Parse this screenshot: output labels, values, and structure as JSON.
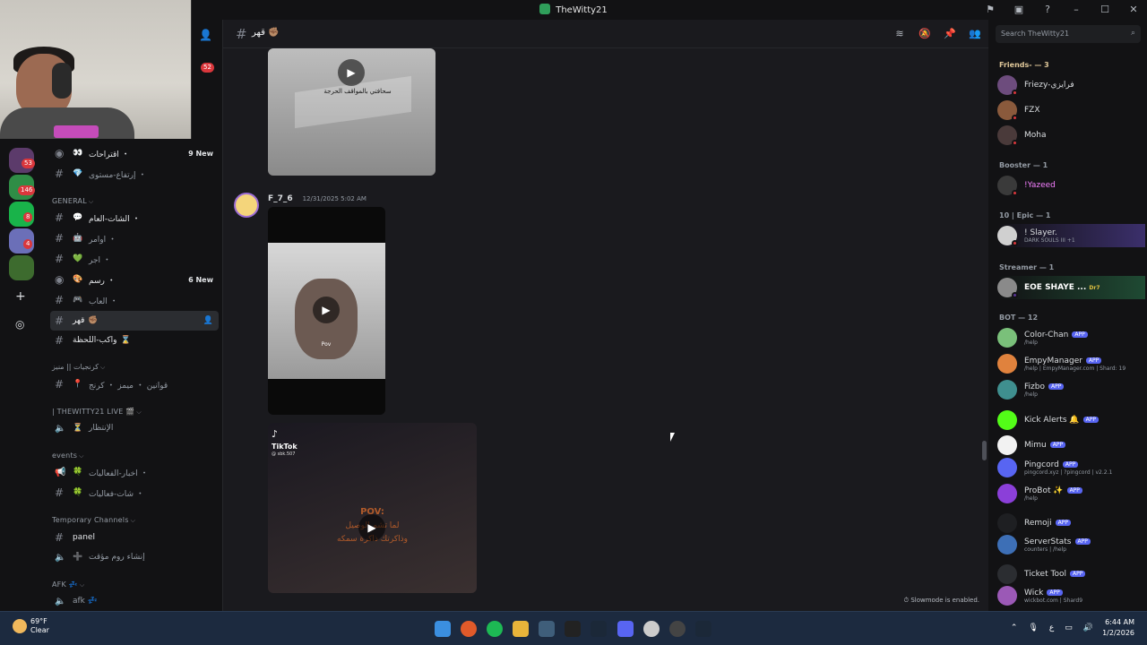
{
  "window": {
    "title": "TheWitty21"
  },
  "channels": {
    "items": [
      {
        "label": "اقتراحات ・",
        "emoji": "👀",
        "type": "text",
        "new": "9 New"
      },
      {
        "label": "إرتفاع-مستوى ・",
        "emoji": "💎",
        "type": "text"
      }
    ],
    "general_cat": "GENERAL",
    "general": [
      {
        "label": "الشات-العام ・",
        "emoji": "💬"
      },
      {
        "label": "اوامر ・",
        "emoji": "🤖"
      },
      {
        "label": "اجر ・",
        "emoji": "💚"
      },
      {
        "label": "رسم ・",
        "emoji": "🎨",
        "new": "6 New"
      },
      {
        "label": "العاب ・",
        "emoji": "🎮"
      },
      {
        "label": "قهر",
        "emoji": "✊🏽"
      },
      {
        "label": "واكب-اللحظة",
        "emoji": "⌛"
      }
    ],
    "cat2": "كرنجيات || منيز",
    "cat2_items": [
      {
        "label": "قوانين ・ ميمز ・ كرنج",
        "emoji": "📍"
      }
    ],
    "cat3": "| THEWITTY21 LIVE 🎬",
    "cat3_items": [
      {
        "label": "الإنتظار",
        "emoji": "⏳"
      }
    ],
    "cat4": "events",
    "cat4_items": [
      {
        "label": "اخبار-الفعاليات ・",
        "emoji": "🍀"
      },
      {
        "label": "شات-فعاليات ・",
        "emoji": "🍀"
      }
    ],
    "cat5": "Temporary Channels",
    "cat5_items": [
      {
        "label": "panel"
      },
      {
        "label": "إنشاء روم مؤقت",
        "emoji": "➕"
      }
    ],
    "cat6": "AFK 💤",
    "cat6_items": [
      {
        "label": "afk 💤"
      }
    ]
  },
  "header": {
    "channel_name": "قهر ✊🏽"
  },
  "messages": [
    {
      "author": "F_7_6",
      "timestamp": "12/31/2025 5:02 AM"
    }
  ],
  "videos": {
    "v1_caption": "سحافتي بالمواقف الحرجة",
    "v2_caption": "Pov",
    "v3_tiktok": "TikTok",
    "v3_handle": "@ sbk.507",
    "v3_pov": "POV:",
    "v3_line1": "لما تشم الوصيل",
    "v3_line2": "وذاكرتك ذاكرة سمكه"
  },
  "slowmode": "Slowmode is enabled.",
  "search": {
    "placeholder": "Search TheWitty21"
  },
  "members": {
    "friends_label": "Friends- — 3",
    "friends": [
      {
        "name": "Friezy-فرايزي"
      },
      {
        "name": "FZX"
      },
      {
        "name": "Moha"
      }
    ],
    "booster_label": "Booster — 1",
    "booster": [
      {
        "name": "!Yazeed"
      }
    ],
    "epic_label": "10 | Epic — 1",
    "epic": [
      {
        "name": "! Slayer.",
        "sub": "DARK SOULS III +1"
      }
    ],
    "streamer_label": "Streamer — 1",
    "streamer": [
      {
        "name": "EOE SHAYE ...",
        "tag": "Dr7"
      }
    ],
    "bot_label": "BOT — 12",
    "bots": [
      {
        "name": "Color-Chan",
        "sub": "/help",
        "color": "#7ac07a"
      },
      {
        "name": "EmpyManager",
        "sub": "/help | EmpyManager.com | Shard: 19",
        "color": "#e0823d"
      },
      {
        "name": "Fizbo",
        "sub": "/help",
        "color": "#3f8f8f"
      },
      {
        "name": "Kick Alerts 🔔",
        "sub": "",
        "color": "#53fc18"
      },
      {
        "name": "Mimu",
        "sub": "",
        "color": "#f2f2f2"
      },
      {
        "name": "Pingcord",
        "sub": "pingcord.xyz | ?pingcord | v2.2.1",
        "color": "#5865f2"
      },
      {
        "name": "ProBot ✨",
        "sub": "/help",
        "color": "#8b3fd9"
      },
      {
        "name": "Remoji",
        "sub": "",
        "color": "#1e1f22"
      },
      {
        "name": "ServerStats",
        "sub": "counters | /help",
        "color": "#3d6fb6"
      },
      {
        "name": "Ticket Tool",
        "sub": "",
        "color": "#2b2d31"
      },
      {
        "name": "Wick",
        "sub": "wickbot.com | Shard9",
        "color": "#9b59b6"
      }
    ],
    "app_label": "APP"
  },
  "taskbar": {
    "temp": "69°F",
    "cond": "Clear",
    "time": "6:44 AM",
    "date": "1/2/2026"
  },
  "servers": {
    "badges": [
      "53",
      "146",
      "8",
      "4"
    ]
  },
  "colors": {
    "accent": "#5865f2",
    "danger": "#da373c",
    "online": "#23a55a"
  }
}
